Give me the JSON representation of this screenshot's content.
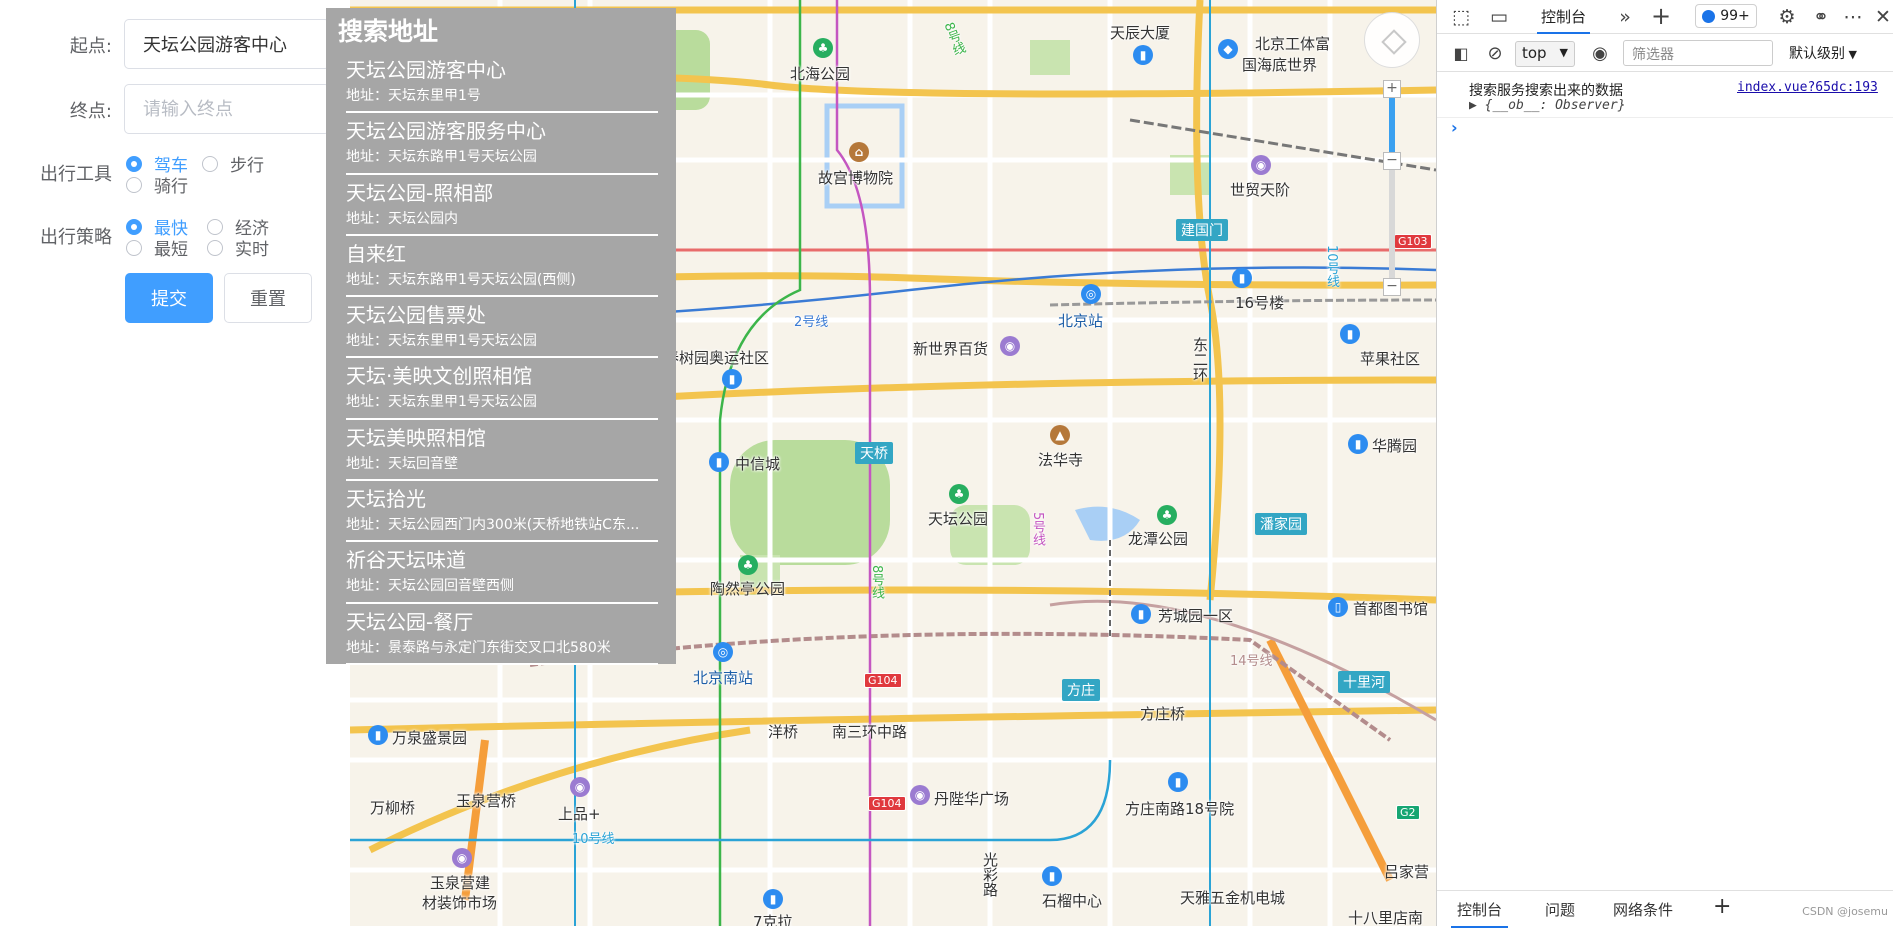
{
  "form": {
    "start_label": "起点:",
    "start_value": "天坛公园游客中心",
    "end_label": "终点:",
    "end_placeholder": "请输入终点",
    "mode_label": "出行工具",
    "modes": [
      "驾车",
      "步行",
      "骑行"
    ],
    "mode_selected": "驾车",
    "strategy_label": "出行策略",
    "strategies": [
      "最快",
      "经济",
      "最短",
      "实时"
    ],
    "strategy_selected": "最快",
    "submit_label": "提交",
    "reset_label": "重置"
  },
  "dropdown": {
    "title": "搜索地址",
    "results": [
      {
        "name": "天坛公园游客中心",
        "address": "地址：天坛东里甲1号"
      },
      {
        "name": "天坛公园游客服务中心",
        "address": "地址：天坛东路甲1号天坛公园"
      },
      {
        "name": "天坛公园-照相部",
        "address": "地址：天坛公园内"
      },
      {
        "name": "自来红",
        "address": "地址：天坛东路甲1号天坛公园(西侧)"
      },
      {
        "name": "天坛公园售票处",
        "address": "地址：天坛东里甲1号天坛公园"
      },
      {
        "name": "天坛·美映文创照相馆",
        "address": "地址：天坛东里甲1号天坛公园"
      },
      {
        "name": "天坛美映照相馆",
        "address": "地址：天坛回音壁"
      },
      {
        "name": "天坛拾光",
        "address": "地址：天坛公园西门内300米(天桥地铁站C东..."
      },
      {
        "name": "祈谷天坛味道",
        "address": "地址：天坛公园回音壁西侧"
      },
      {
        "name": "天坛公园-餐厅",
        "address": "地址：景泰路与永定门东街交叉口北580米"
      }
    ]
  },
  "map": {
    "labels": {
      "beihai": "北海公园",
      "gugong": "故宫博物院",
      "tianchen": "天辰大厦",
      "gongti": "北京工体富",
      "haidi": "国海底世界",
      "shimao": "世贸天阶",
      "jianguomen": "建国门",
      "line2": "2号线",
      "beijingzhan": "北京站",
      "xinshijie": "新世界百货",
      "sixteen": "16号楼",
      "pingguo": "苹果社区",
      "chunshu": "春树园奥运社区",
      "zhongxin": "中信城",
      "tianqiao": "天桥",
      "fahuasi": "法华寺",
      "tiantan": "天坛公园",
      "longtan": "龙潭公园",
      "panjiayuan": "潘家园",
      "huateng": "华腾园",
      "taoranting": "陶然亭公园",
      "fangcheng": "芳城园一区",
      "shoudu": "首都图书馆",
      "line14": "14号线",
      "shilihe": "十里河",
      "nanzhan": "北京南站",
      "fangzhuang": "方庄",
      "fangzhuangqiao": "方庄桥",
      "yangqiao": "洋桥",
      "nansanhuan": "南三环中路",
      "wanquan": "万泉盛景园",
      "danlu": "丹陛华广场",
      "fzn18": "方庄南路18号院",
      "wanliuqiao": "万柳桥",
      "yuquanying": "玉泉营桥",
      "shangpin": "上品+",
      "line10": "10号线",
      "yqyjc1": "玉泉营建",
      "yqyjc2": "材装饰市场",
      "guangcai": "光彩路",
      "shiliu": "石榴中心",
      "tianya": "天雅五金机电城",
      "lvjia": "吕家营",
      "shibali": "十八里店南",
      "qikela": "7克拉",
      "line5": "5号线",
      "line8": "8号线",
      "line8b": "8号线",
      "line10b": "10号线",
      "donger": "东二环",
      "g103": "G103",
      "g104a": "G104",
      "g104b": "G104",
      "g2": "G2"
    }
  },
  "devtools": {
    "tabs": [
      "控制台"
    ],
    "badge": "99+",
    "context": "top",
    "filter_placeholder": "筛选器",
    "level": "默认级别",
    "log_message": "搜索服务搜索出来的数据",
    "log_source": "index.vue?65dc:193",
    "log_object": "▶ {__ob__: Observer}",
    "prompt": "›",
    "bottom_tabs": [
      "控制台",
      "问题",
      "网络条件"
    ],
    "watermark": "CSDN @josemu"
  },
  "colors": {
    "primary": "#409eff",
    "dropdown_bg": "#a6a6a6",
    "park": "#b9dc9c",
    "water": "#a9cff5"
  }
}
